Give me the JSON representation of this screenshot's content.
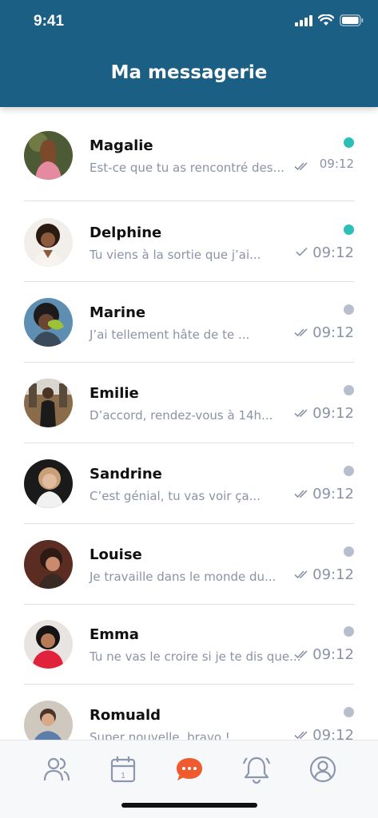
{
  "status_bar": {
    "time": "9:41",
    "icons": [
      "signal-icon",
      "wifi-icon",
      "battery-icon"
    ]
  },
  "header": {
    "title": "Ma messagerie",
    "background": "#1c5f85"
  },
  "colors": {
    "unread_dot": "#2bbfb8",
    "read_dot": "#b7bfcf",
    "active_tab": "#ef5a2f",
    "inactive_tab": "#8c97ad"
  },
  "conversations": [
    {
      "name": "Magalie",
      "preview": "Est-ce que tu as rencontré des...",
      "time": "09:12",
      "status": "unread",
      "ticks": "double",
      "avatar": "avatar-magalie"
    },
    {
      "name": "Delphine",
      "preview": "Tu viens à la sortie que j’ai...",
      "time": "09:12",
      "status": "unread",
      "ticks": "single",
      "avatar": "avatar-delphine"
    },
    {
      "name": "Marine",
      "preview": "J’ai tellement hâte de te ...",
      "time": "09:12",
      "status": "read",
      "ticks": "double",
      "avatar": "avatar-marine"
    },
    {
      "name": "Emilie",
      "preview": "D’accord, rendez-vous à 14h...",
      "time": "09:12",
      "status": "read",
      "ticks": "double",
      "avatar": "avatar-emilie"
    },
    {
      "name": "Sandrine",
      "preview": "C’est génial, tu vas voir ça...",
      "time": "09:12",
      "status": "read",
      "ticks": "double",
      "avatar": "avatar-sandrine"
    },
    {
      "name": "Louise",
      "preview": "Je travaille dans le monde du...",
      "time": "09:12",
      "status": "read",
      "ticks": "double",
      "avatar": "avatar-louise"
    },
    {
      "name": "Emma",
      "preview": "Tu ne vas le croire si je te dis que...",
      "time": "09:12",
      "status": "read",
      "ticks": "double",
      "avatar": "avatar-emma"
    },
    {
      "name": "Romuald",
      "preview": "Super nouvelle, bravo !",
      "time": "09:12",
      "status": "read",
      "ticks": "double",
      "avatar": "avatar-romuald"
    }
  ],
  "tabbar": {
    "tabs": [
      {
        "icon": "contacts-icon",
        "active": false
      },
      {
        "icon": "calendar-icon",
        "active": false
      },
      {
        "icon": "messages-icon",
        "active": true
      },
      {
        "icon": "notifications-icon",
        "active": false
      },
      {
        "icon": "profile-icon",
        "active": false
      }
    ]
  }
}
